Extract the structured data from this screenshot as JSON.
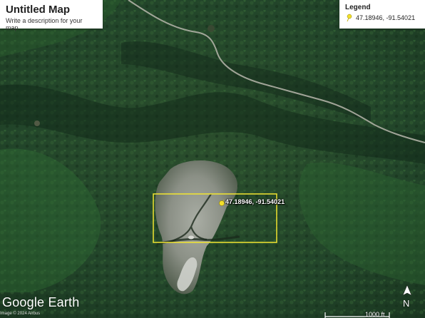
{
  "map": {
    "title": "Untitled Map",
    "description": "Write a description for your map."
  },
  "legend": {
    "title": "Legend",
    "items": [
      {
        "label": "47.18946, -91.54021",
        "icon": "pushpin-icon",
        "color": "#f3e02a"
      }
    ]
  },
  "placemark": {
    "label": "47.18946, -91.54021",
    "icon": "pushpin-icon",
    "color": "#f3e02a"
  },
  "selection_box": {
    "color": "#f2e531"
  },
  "branding": {
    "name": "Google Earth"
  },
  "imagery_credit": "Image © 2024 Airbus",
  "scale_bar": {
    "label": "1000 ft"
  },
  "compass": {
    "label": "N",
    "icon": "north-arrow-icon"
  },
  "colors": {
    "forest_dark": "#1f3a22",
    "forest_mid": "#2d5a2f",
    "rock_clearing": "#9ea39a",
    "road": "#b9b7ad"
  }
}
